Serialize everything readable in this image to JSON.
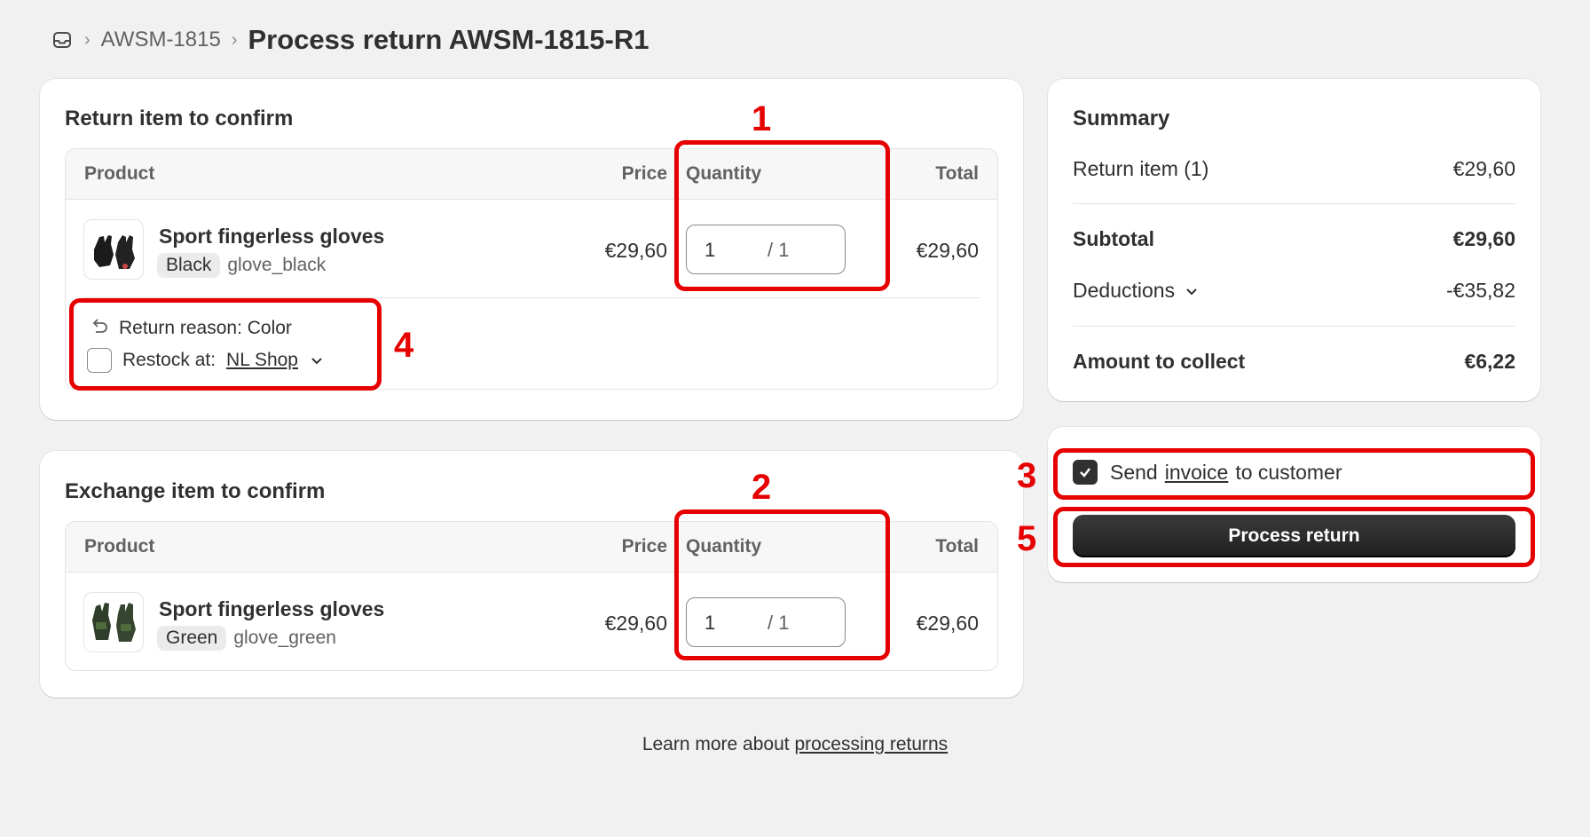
{
  "breadcrumb": {
    "parent": "AWSM-1815",
    "title": "Process return AWSM-1815-R1"
  },
  "return_card": {
    "title": "Return item to confirm",
    "columns": {
      "product": "Product",
      "price": "Price",
      "quantity": "Quantity",
      "total": "Total"
    },
    "item": {
      "name": "Sport fingerless gloves",
      "variant": "Black",
      "sku": "glove_black",
      "price": "€29,60",
      "quantity": "1",
      "quantity_max": "/ 1",
      "total": "€29,60"
    },
    "reason": "Return reason: Color",
    "restock_label": "Restock at:",
    "restock_location": "NL Shop"
  },
  "exchange_card": {
    "title": "Exchange item to confirm",
    "columns": {
      "product": "Product",
      "price": "Price",
      "quantity": "Quantity",
      "total": "Total"
    },
    "item": {
      "name": "Sport fingerless gloves",
      "variant": "Green",
      "sku": "glove_green",
      "price": "€29,60",
      "quantity": "1",
      "quantity_max": "/ 1",
      "total": "€29,60"
    }
  },
  "summary": {
    "title": "Summary",
    "return_item_label": "Return item (1)",
    "return_item_value": "€29,60",
    "subtotal_label": "Subtotal",
    "subtotal_value": "€29,60",
    "deductions_label": "Deductions",
    "deductions_value": "-€35,82",
    "amount_label": "Amount to collect",
    "amount_value": "€6,22"
  },
  "action": {
    "send_prefix": "Send",
    "send_link": "invoice",
    "send_suffix": "to customer",
    "process_button": "Process return"
  },
  "footer": {
    "text": "Learn more about",
    "link": "processing returns"
  },
  "annotations": {
    "n1": "1",
    "n2": "2",
    "n3": "3",
    "n4": "4",
    "n5": "5",
    "color": "#e60000"
  }
}
